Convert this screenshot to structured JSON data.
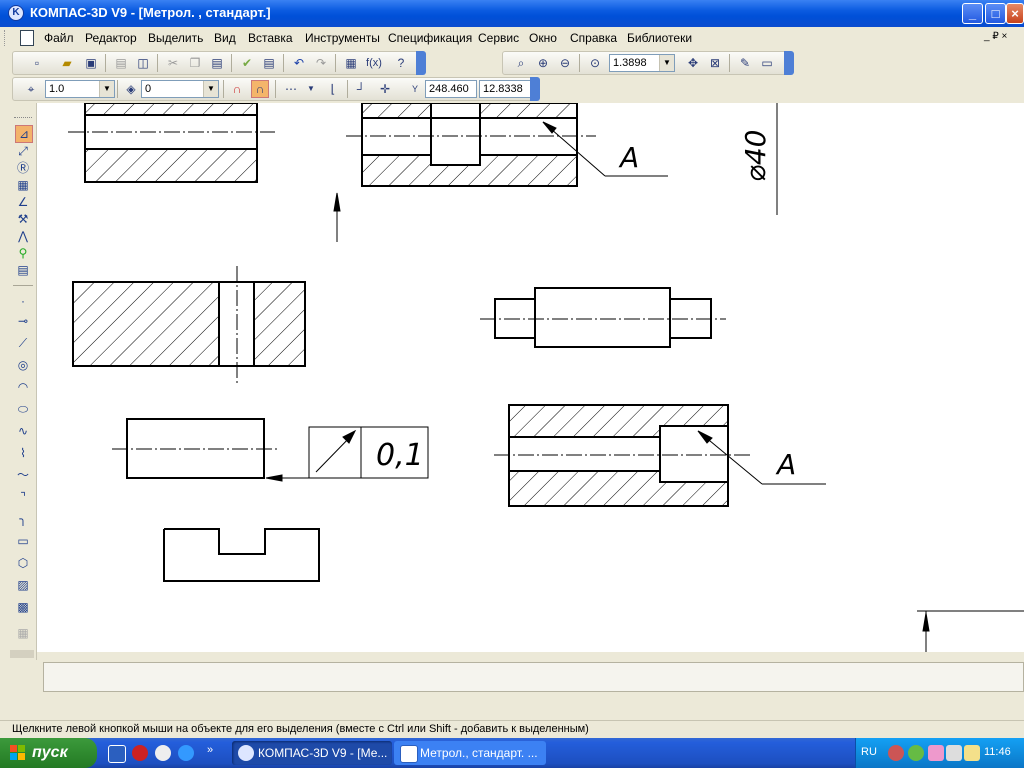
{
  "window": {
    "title": "КОМПАС-3D V9 - [Метрол. , стандарт.]"
  },
  "titlebar_buttons": [
    "minimize-button",
    "maximize-button",
    "close-button"
  ],
  "menu": {
    "items": [
      "Файл",
      "Редактор",
      "Выделить",
      "Вид",
      "Вставка",
      "Инструменты",
      "Спецификация",
      "Сервис",
      "Окно",
      "Справка",
      "Библиотеки"
    ],
    "doc_controls": "_ ₽ ×"
  },
  "toolbar": {
    "zoom_value": "1.3898",
    "line_scale_value": "1.0",
    "layer_value": "0",
    "coord_x": "248.460",
    "coord_y": "12.8338",
    "fx_label": "f(x)"
  },
  "drawing": {
    "label_a_top": "A",
    "label_a_bottom": "A",
    "diameter_label": "⌀40",
    "tolerance_value": "0,1"
  },
  "status": {
    "hint": "Щелкните левой кнопкой мыши на объекте для его выделения (вместе с Ctrl или Shift - добавить к выделенным)"
  },
  "taskbar": {
    "start_label": "пуск",
    "tasks": [
      "КОМПАС-3D V9 - [Ме...",
      "Метрол., стандарт. ..."
    ],
    "language": "RU",
    "clock": "11:46"
  }
}
